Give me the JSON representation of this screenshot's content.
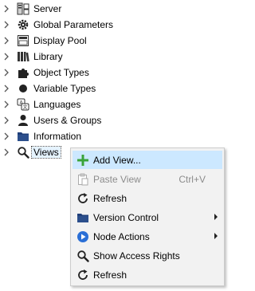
{
  "tree": {
    "items": [
      {
        "label": "Server",
        "icon": "server-icon"
      },
      {
        "label": "Global Parameters",
        "icon": "gear-icon"
      },
      {
        "label": "Display Pool",
        "icon": "folder-icon"
      },
      {
        "label": "Library",
        "icon": "library-icon"
      },
      {
        "label": "Object Types",
        "icon": "puzzle-icon"
      },
      {
        "label": "Variable Types",
        "icon": "dot-icon"
      },
      {
        "label": "Languages",
        "icon": "languages-icon"
      },
      {
        "label": "Users & Groups",
        "icon": "user-icon"
      },
      {
        "label": "Information",
        "icon": "folder-icon"
      },
      {
        "label": "Views",
        "icon": "search-icon"
      }
    ]
  },
  "context_menu": {
    "items": [
      {
        "label": "Add View...",
        "icon": "plus-icon"
      },
      {
        "label": "Paste View",
        "shortcut": "Ctrl+V",
        "icon": "paste-icon"
      },
      {
        "label": "Refresh",
        "icon": "refresh-icon"
      },
      {
        "label": "Version Control",
        "icon": "folder-icon"
      },
      {
        "label": "Node Actions",
        "icon": "play-icon"
      },
      {
        "label": "Show Access Rights",
        "icon": "search-icon"
      },
      {
        "label": "Refresh",
        "icon": "refresh-icon"
      }
    ]
  },
  "colors": {
    "selection": "#e5f3ff",
    "menu_hover": "#cce8ff",
    "menu_background": "#f2f2f2",
    "disabled_text": "#8c8c8c",
    "plus_green": "#3aa33a",
    "folder_navy": "#1f3f7a",
    "play_blue": "#2a6fd6"
  }
}
